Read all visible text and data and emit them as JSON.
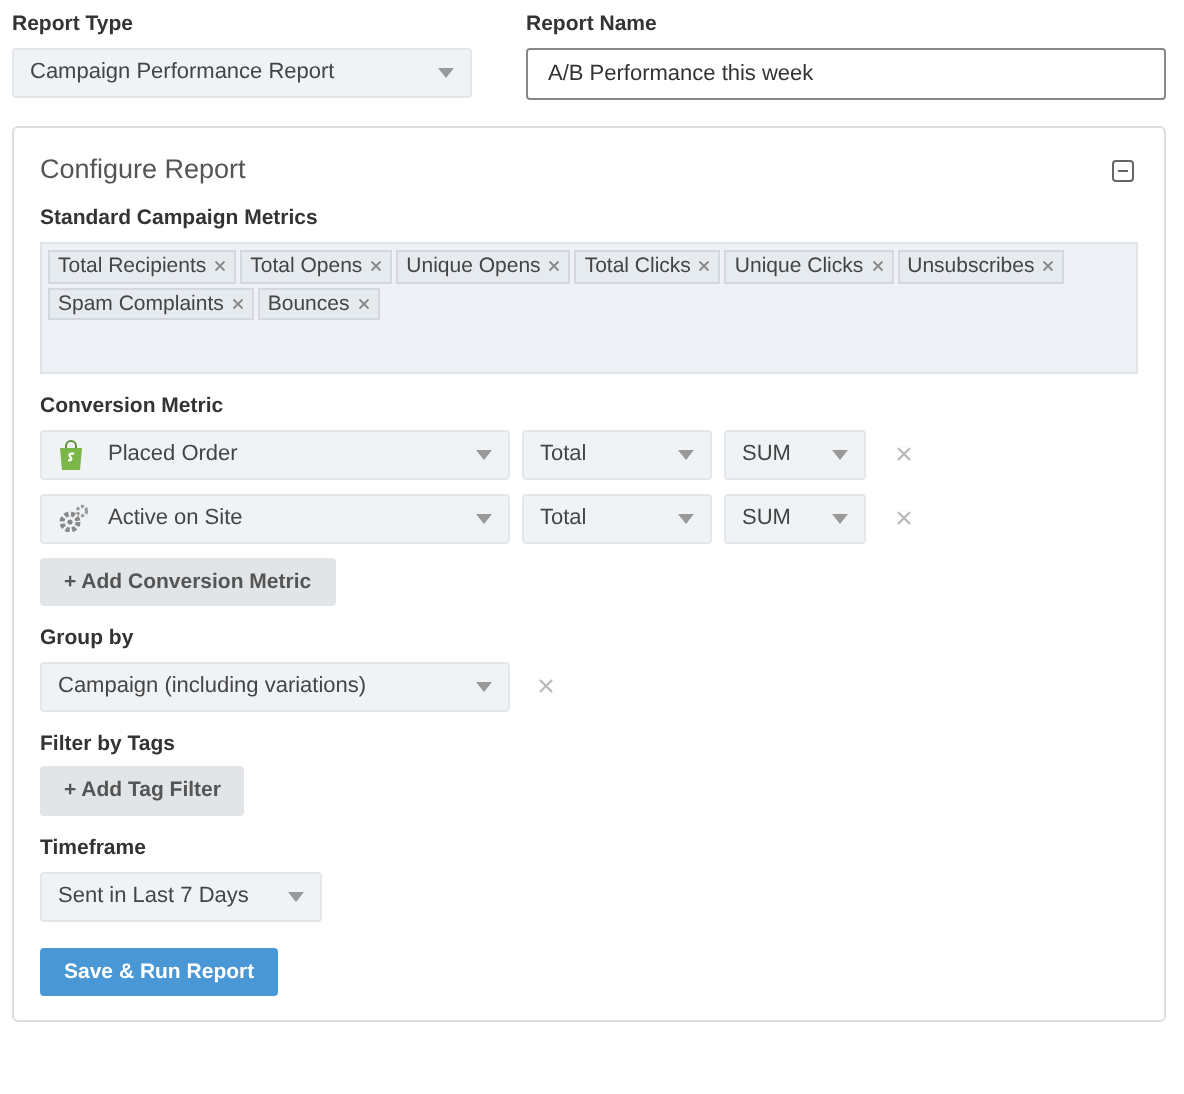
{
  "report_type": {
    "label": "Report Type",
    "value": "Campaign Performance Report"
  },
  "report_name": {
    "label": "Report Name",
    "value": "A/B Performance this week"
  },
  "configure": {
    "title": "Configure Report",
    "standard_metrics": {
      "label": "Standard Campaign Metrics",
      "tags": [
        "Total Recipients",
        "Total Opens",
        "Unique Opens",
        "Total Clicks",
        "Unique Clicks",
        "Unsubscribes",
        "Spam Complaints",
        "Bounces"
      ]
    },
    "conversion": {
      "label": "Conversion Metric",
      "rows": [
        {
          "kind": "bag",
          "metric": "Placed Order",
          "measure": "Total",
          "aggregate": "SUM"
        },
        {
          "kind": "gear",
          "metric": "Active on Site",
          "measure": "Total",
          "aggregate": "SUM"
        }
      ],
      "add_button": "+ Add Conversion Metric"
    },
    "group_by": {
      "label": "Group by",
      "value": "Campaign (including variations)"
    },
    "filter": {
      "label": "Filter by Tags",
      "add_button": "+ Add Tag Filter"
    },
    "timeframe": {
      "label": "Timeframe",
      "value": "Sent in Last 7 Days"
    },
    "submit": "Save & Run Report"
  }
}
